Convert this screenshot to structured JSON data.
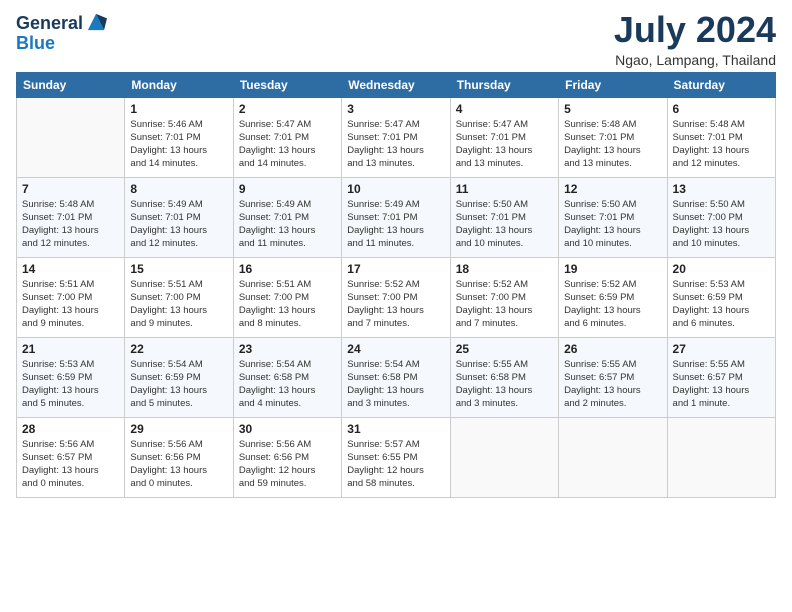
{
  "header": {
    "logo_line1": "General",
    "logo_line2": "Blue",
    "month_title": "July 2024",
    "location": "Ngao, Lampang, Thailand"
  },
  "days_of_week": [
    "Sunday",
    "Monday",
    "Tuesday",
    "Wednesday",
    "Thursday",
    "Friday",
    "Saturday"
  ],
  "weeks": [
    [
      {
        "day": "",
        "info": ""
      },
      {
        "day": "1",
        "info": "Sunrise: 5:46 AM\nSunset: 7:01 PM\nDaylight: 13 hours\nand 14 minutes."
      },
      {
        "day": "2",
        "info": "Sunrise: 5:47 AM\nSunset: 7:01 PM\nDaylight: 13 hours\nand 14 minutes."
      },
      {
        "day": "3",
        "info": "Sunrise: 5:47 AM\nSunset: 7:01 PM\nDaylight: 13 hours\nand 13 minutes."
      },
      {
        "day": "4",
        "info": "Sunrise: 5:47 AM\nSunset: 7:01 PM\nDaylight: 13 hours\nand 13 minutes."
      },
      {
        "day": "5",
        "info": "Sunrise: 5:48 AM\nSunset: 7:01 PM\nDaylight: 13 hours\nand 13 minutes."
      },
      {
        "day": "6",
        "info": "Sunrise: 5:48 AM\nSunset: 7:01 PM\nDaylight: 13 hours\nand 12 minutes."
      }
    ],
    [
      {
        "day": "7",
        "info": "Sunrise: 5:48 AM\nSunset: 7:01 PM\nDaylight: 13 hours\nand 12 minutes."
      },
      {
        "day": "8",
        "info": "Sunrise: 5:49 AM\nSunset: 7:01 PM\nDaylight: 13 hours\nand 12 minutes."
      },
      {
        "day": "9",
        "info": "Sunrise: 5:49 AM\nSunset: 7:01 PM\nDaylight: 13 hours\nand 11 minutes."
      },
      {
        "day": "10",
        "info": "Sunrise: 5:49 AM\nSunset: 7:01 PM\nDaylight: 13 hours\nand 11 minutes."
      },
      {
        "day": "11",
        "info": "Sunrise: 5:50 AM\nSunset: 7:01 PM\nDaylight: 13 hours\nand 10 minutes."
      },
      {
        "day": "12",
        "info": "Sunrise: 5:50 AM\nSunset: 7:01 PM\nDaylight: 13 hours\nand 10 minutes."
      },
      {
        "day": "13",
        "info": "Sunrise: 5:50 AM\nSunset: 7:00 PM\nDaylight: 13 hours\nand 10 minutes."
      }
    ],
    [
      {
        "day": "14",
        "info": "Sunrise: 5:51 AM\nSunset: 7:00 PM\nDaylight: 13 hours\nand 9 minutes."
      },
      {
        "day": "15",
        "info": "Sunrise: 5:51 AM\nSunset: 7:00 PM\nDaylight: 13 hours\nand 9 minutes."
      },
      {
        "day": "16",
        "info": "Sunrise: 5:51 AM\nSunset: 7:00 PM\nDaylight: 13 hours\nand 8 minutes."
      },
      {
        "day": "17",
        "info": "Sunrise: 5:52 AM\nSunset: 7:00 PM\nDaylight: 13 hours\nand 7 minutes."
      },
      {
        "day": "18",
        "info": "Sunrise: 5:52 AM\nSunset: 7:00 PM\nDaylight: 13 hours\nand 7 minutes."
      },
      {
        "day": "19",
        "info": "Sunrise: 5:52 AM\nSunset: 6:59 PM\nDaylight: 13 hours\nand 6 minutes."
      },
      {
        "day": "20",
        "info": "Sunrise: 5:53 AM\nSunset: 6:59 PM\nDaylight: 13 hours\nand 6 minutes."
      }
    ],
    [
      {
        "day": "21",
        "info": "Sunrise: 5:53 AM\nSunset: 6:59 PM\nDaylight: 13 hours\nand 5 minutes."
      },
      {
        "day": "22",
        "info": "Sunrise: 5:54 AM\nSunset: 6:59 PM\nDaylight: 13 hours\nand 5 minutes."
      },
      {
        "day": "23",
        "info": "Sunrise: 5:54 AM\nSunset: 6:58 PM\nDaylight: 13 hours\nand 4 minutes."
      },
      {
        "day": "24",
        "info": "Sunrise: 5:54 AM\nSunset: 6:58 PM\nDaylight: 13 hours\nand 3 minutes."
      },
      {
        "day": "25",
        "info": "Sunrise: 5:55 AM\nSunset: 6:58 PM\nDaylight: 13 hours\nand 3 minutes."
      },
      {
        "day": "26",
        "info": "Sunrise: 5:55 AM\nSunset: 6:57 PM\nDaylight: 13 hours\nand 2 minutes."
      },
      {
        "day": "27",
        "info": "Sunrise: 5:55 AM\nSunset: 6:57 PM\nDaylight: 13 hours\nand 1 minute."
      }
    ],
    [
      {
        "day": "28",
        "info": "Sunrise: 5:56 AM\nSunset: 6:57 PM\nDaylight: 13 hours\nand 0 minutes."
      },
      {
        "day": "29",
        "info": "Sunrise: 5:56 AM\nSunset: 6:56 PM\nDaylight: 13 hours\nand 0 minutes."
      },
      {
        "day": "30",
        "info": "Sunrise: 5:56 AM\nSunset: 6:56 PM\nDaylight: 12 hours\nand 59 minutes."
      },
      {
        "day": "31",
        "info": "Sunrise: 5:57 AM\nSunset: 6:55 PM\nDaylight: 12 hours\nand 58 minutes."
      },
      {
        "day": "",
        "info": ""
      },
      {
        "day": "",
        "info": ""
      },
      {
        "day": "",
        "info": ""
      }
    ]
  ]
}
